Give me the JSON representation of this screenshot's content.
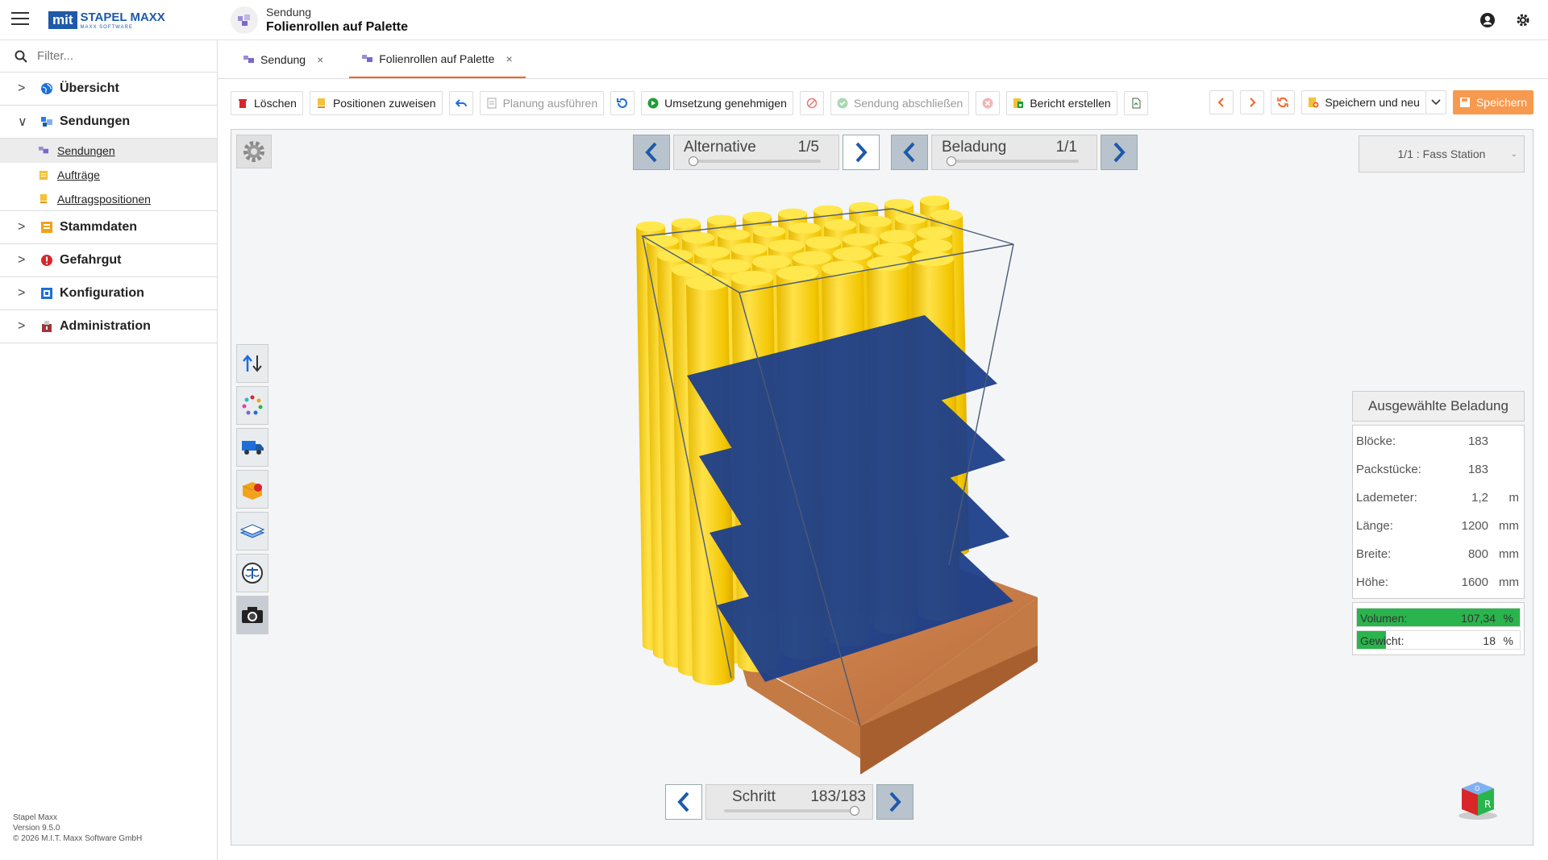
{
  "header": {
    "logo_box": "mit",
    "logo_name": "STAPEL MAXX",
    "logo_sub": "MAXX SOFTWARE",
    "crumb_small": "Sendung",
    "crumb_big": "Folienrollen auf Palette",
    "icons": [
      "account-circle-icon",
      "settings-gear-icon"
    ]
  },
  "sidebar": {
    "filter_placeholder": "Filter...",
    "items": [
      {
        "label": "Übersicht",
        "icon": "globe-icon",
        "color": "#1e6fd9"
      },
      {
        "label": "Sendungen",
        "icon": "shipment-icon",
        "color": "#2b7de9"
      },
      {
        "label": "Stammdaten",
        "icon": "masterdata-icon",
        "color": "#f2a31b"
      },
      {
        "label": "Gefahrgut",
        "icon": "danger-icon",
        "color": "#d9262a"
      },
      {
        "label": "Konfiguration",
        "icon": "config-icon",
        "color": "#1e6fd9"
      },
      {
        "label": "Administration",
        "icon": "admin-icon",
        "color": "#a0343b"
      }
    ],
    "sub_items": [
      {
        "label": "Sendungen"
      },
      {
        "label": "Aufträge"
      },
      {
        "label": "Auftragspositionen"
      }
    ],
    "footer": {
      "line1": "Stapel Maxx",
      "line2": "Version 9.5.0",
      "line3": "© 2026 M.I.T. Maxx Software GmbH"
    }
  },
  "tabs": [
    {
      "label": "Sendung",
      "close": "×"
    },
    {
      "label": "Folienrollen auf Palette",
      "close": "×"
    }
  ],
  "toolbar": {
    "delete": "Löschen",
    "assign": "Positionen zuweisen",
    "plan": "Planung ausführen",
    "approve": "Umsetzung genehmigen",
    "finish": "Sendung abschließen",
    "report": "Bericht erstellen",
    "save_new": "Speichern und neu",
    "save": "Speichern"
  },
  "viewer": {
    "alternative_label": "Alternative",
    "alternative_value": "1/5",
    "loading_label": "Beladung",
    "loading_value": "1/1",
    "station": "1/1 : Fass Station",
    "step_label": "Schritt",
    "step_value": "183/183",
    "step_fraction": 1.0,
    "tools": [
      "axis-swap-icon",
      "color-dots-icon",
      "truck-icon",
      "box-icon",
      "layers-icon",
      "scale-icon",
      "camera-icon"
    ]
  },
  "info": {
    "title": "Ausgewählte Beladung",
    "rows": [
      {
        "k": "Blöcke:",
        "v": "183",
        "u": ""
      },
      {
        "k": "Packstücke:",
        "v": "183",
        "u": ""
      },
      {
        "k": "Lademeter:",
        "v": "1,2",
        "u": "m"
      },
      {
        "k": "Länge:",
        "v": "1200",
        "u": "mm"
      },
      {
        "k": "Breite:",
        "v": "800",
        "u": "mm"
      },
      {
        "k": "Höhe:",
        "v": "1600",
        "u": "mm"
      }
    ],
    "volume_label": "Volumen:",
    "volume_value": "107,34",
    "volume_unit": "%",
    "volume_fraction": 1.0,
    "weight_label": "Gewicht:",
    "weight_value": "18",
    "weight_unit": "%",
    "weight_fraction": 0.18
  }
}
